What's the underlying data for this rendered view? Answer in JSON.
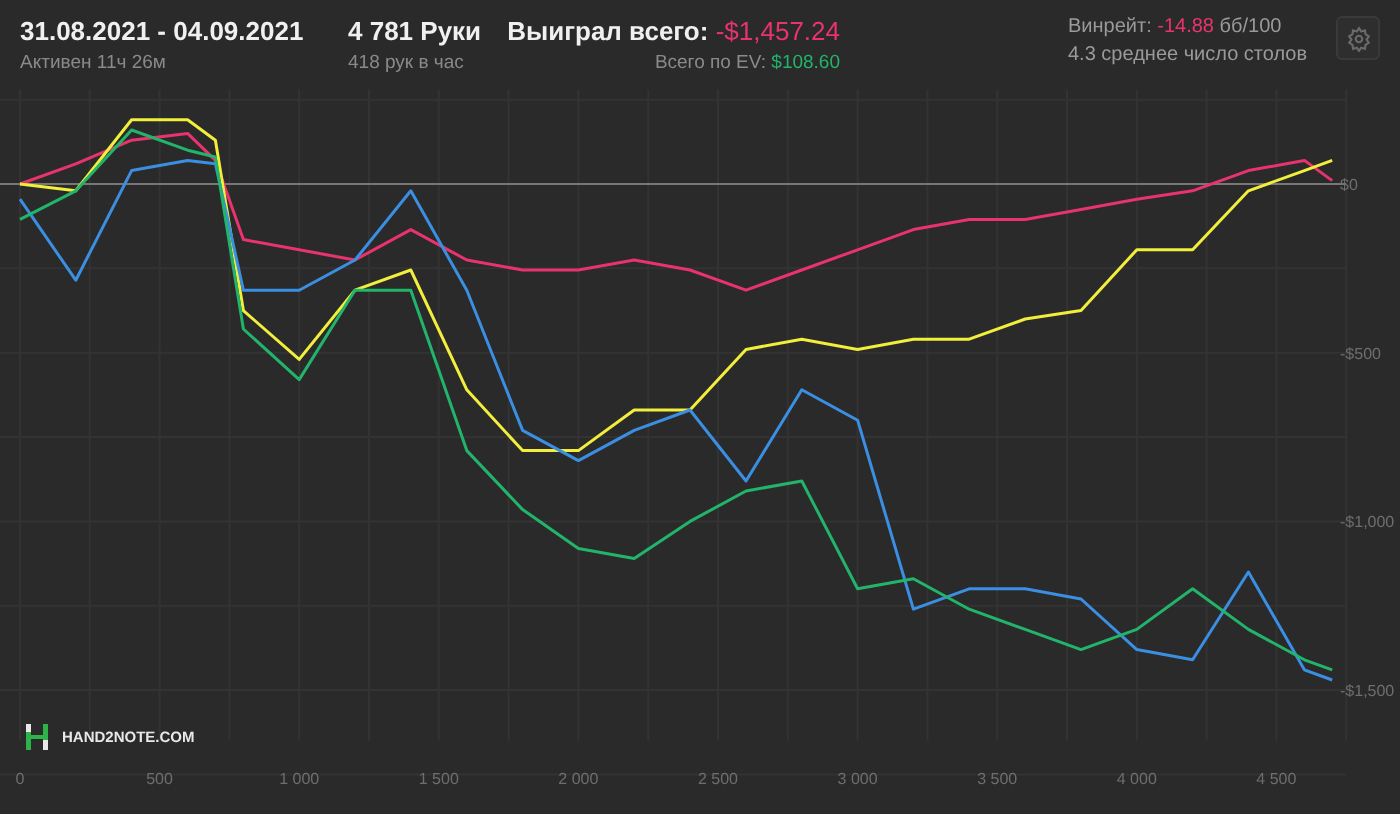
{
  "header": {
    "date_range": "31.08.2021 - 04.09.2021",
    "active_time": "Активен 11ч 26м",
    "hands": "4 781 Руки",
    "hands_per_hour": "418 рук в час",
    "won_total": {
      "label": "Выиграл всего:",
      "value": "-$1,457.24",
      "color": "#e8336d"
    },
    "ev_total": {
      "label": "Всего по EV:",
      "value": "$108.60",
      "color": "#22b46a"
    },
    "winrate": {
      "label": "Винрейт:",
      "value": "-14.88",
      "color": "#e8336d",
      "unit": "бб/100"
    },
    "avg_tables": "4.3 среднее число столов"
  },
  "chart": {
    "logo": "HAND2NOTE.COM",
    "chart_data": {
      "type": "line",
      "x": [
        0,
        200,
        400,
        600,
        700,
        800,
        1000,
        1200,
        1400,
        1600,
        1800,
        2000,
        2200,
        2400,
        2600,
        2800,
        3000,
        3200,
        3400,
        3600,
        3800,
        4000,
        4200,
        4400,
        4600,
        4700
      ],
      "series": [
        {
          "color": "#e8336d",
          "values": [
            0,
            60,
            130,
            150,
            70,
            -165,
            -195,
            -225,
            -135,
            -225,
            -255,
            -255,
            -225,
            -255,
            -315,
            -255,
            -195,
            -135,
            -105,
            -105,
            -75,
            -45,
            -20,
            40,
            70,
            10
          ]
        },
        {
          "color": "#f2ee3c",
          "values": [
            0,
            -20,
            190,
            190,
            130,
            -375,
            -520,
            -315,
            -255,
            -610,
            -790,
            -790,
            -670,
            -670,
            -490,
            -460,
            -490,
            -460,
            -460,
            -400,
            -375,
            -195,
            -195,
            -20,
            40,
            70
          ]
        },
        {
          "color": "#3b8fe2",
          "values": [
            -45,
            -285,
            40,
            70,
            60,
            -315,
            -315,
            -225,
            -20,
            -315,
            -730,
            -820,
            -730,
            -670,
            -880,
            -610,
            -700,
            -1260,
            -1200,
            -1200,
            -1230,
            -1380,
            -1410,
            -1150,
            -1440,
            -1470
          ]
        },
        {
          "color": "#22b46a",
          "values": [
            -105,
            -20,
            160,
            100,
            80,
            -430,
            -580,
            -315,
            -315,
            -790,
            -965,
            -1080,
            -1110,
            -1000,
            -910,
            -880,
            -1200,
            -1170,
            -1260,
            -1320,
            -1380,
            -1320,
            -1200,
            -1320,
            -1410,
            -1440
          ]
        }
      ],
      "xticks": [
        {
          "value": 0,
          "label": "0"
        },
        {
          "value": 500,
          "label": "500"
        },
        {
          "value": 1000,
          "label": "1 000"
        },
        {
          "value": 1500,
          "label": "1 500"
        },
        {
          "value": 2000,
          "label": "2 000"
        },
        {
          "value": 2500,
          "label": "2 500"
        },
        {
          "value": 3000,
          "label": "3 000"
        },
        {
          "value": 3500,
          "label": "3 500"
        },
        {
          "value": 4000,
          "label": "4 000"
        },
        {
          "value": 4500,
          "label": "4 500"
        }
      ],
      "xlim": [
        0,
        4750
      ],
      "ylim": [
        -1650,
        280
      ],
      "grid": true,
      "yticks": [
        {
          "value": 0,
          "label": "$0"
        },
        {
          "value": -500,
          "label": "-$500"
        },
        {
          "value": -1000,
          "label": "-$1,000"
        },
        {
          "value": -1500,
          "label": "-$1,500"
        }
      ]
    }
  }
}
